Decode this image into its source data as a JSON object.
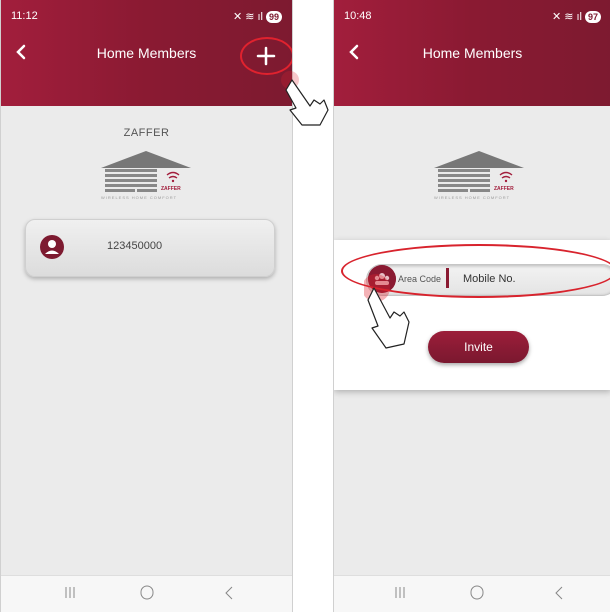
{
  "left": {
    "status": {
      "time": "11:12 ",
      "battery": "99"
    },
    "header": {
      "title": "Home Members"
    },
    "brand": "ZAFFER",
    "logo_text": "ZAFFER",
    "logo_tagline": "WIRELESS HOME COMFORT",
    "members": [
      {
        "number": "123450000"
      }
    ]
  },
  "right": {
    "status": {
      "time": "10:48",
      "battery": "97"
    },
    "header": {
      "title": "Home Members"
    },
    "logo_text": "ZAFFER",
    "logo_tagline": "WIRELESS HOME COMFORT",
    "invite": {
      "area_code_label": "Area Code",
      "mobile_placeholder": "Mobile No.",
      "button_label": "Invite"
    }
  },
  "colors": {
    "header": "#8a1a32",
    "accent": "#7d1a30",
    "highlight": "#e0222e"
  },
  "icons": [
    "back-icon",
    "plus-icon",
    "person-icon",
    "country-flag-icon",
    "recent-apps-icon",
    "home-icon",
    "nav-back-icon",
    "tap-hand-icon"
  ]
}
